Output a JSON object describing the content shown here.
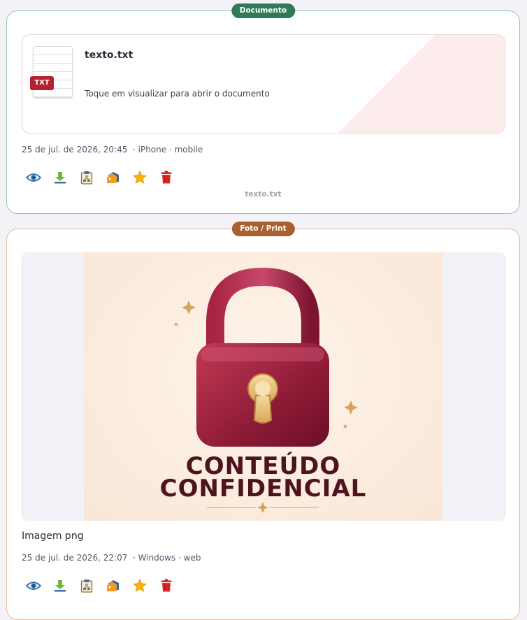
{
  "document_card": {
    "badge": "Documento",
    "file_name": "texto.txt",
    "file_type_tag": "TXT",
    "hint": "Toque em visualizar para abrir o documento",
    "meta": "25 de jul. de 2026, 20:45  · iPhone · mobile",
    "footer_name": "texto.txt",
    "icons": [
      "eye-icon",
      "download-icon",
      "clipboard-icon",
      "tag-icon",
      "star-icon",
      "trash-icon"
    ]
  },
  "photo_card": {
    "badge": "Foto / Print",
    "image_text_line1": "CONTEÚDO",
    "image_text_line2": "CONFIDENCIAL",
    "caption": "Imagem png",
    "meta": "25 de jul. de 2026, 22:07  · Windows · web",
    "icons": [
      "eye-icon",
      "download-icon",
      "clipboard-icon",
      "tag-icon",
      "star-icon",
      "trash-icon"
    ]
  },
  "colors": {
    "doc_accent": "#2f7a5a",
    "photo_accent": "#a8612e",
    "lock_red": "#9e1f3a",
    "txt_tag": "#b7202e"
  }
}
